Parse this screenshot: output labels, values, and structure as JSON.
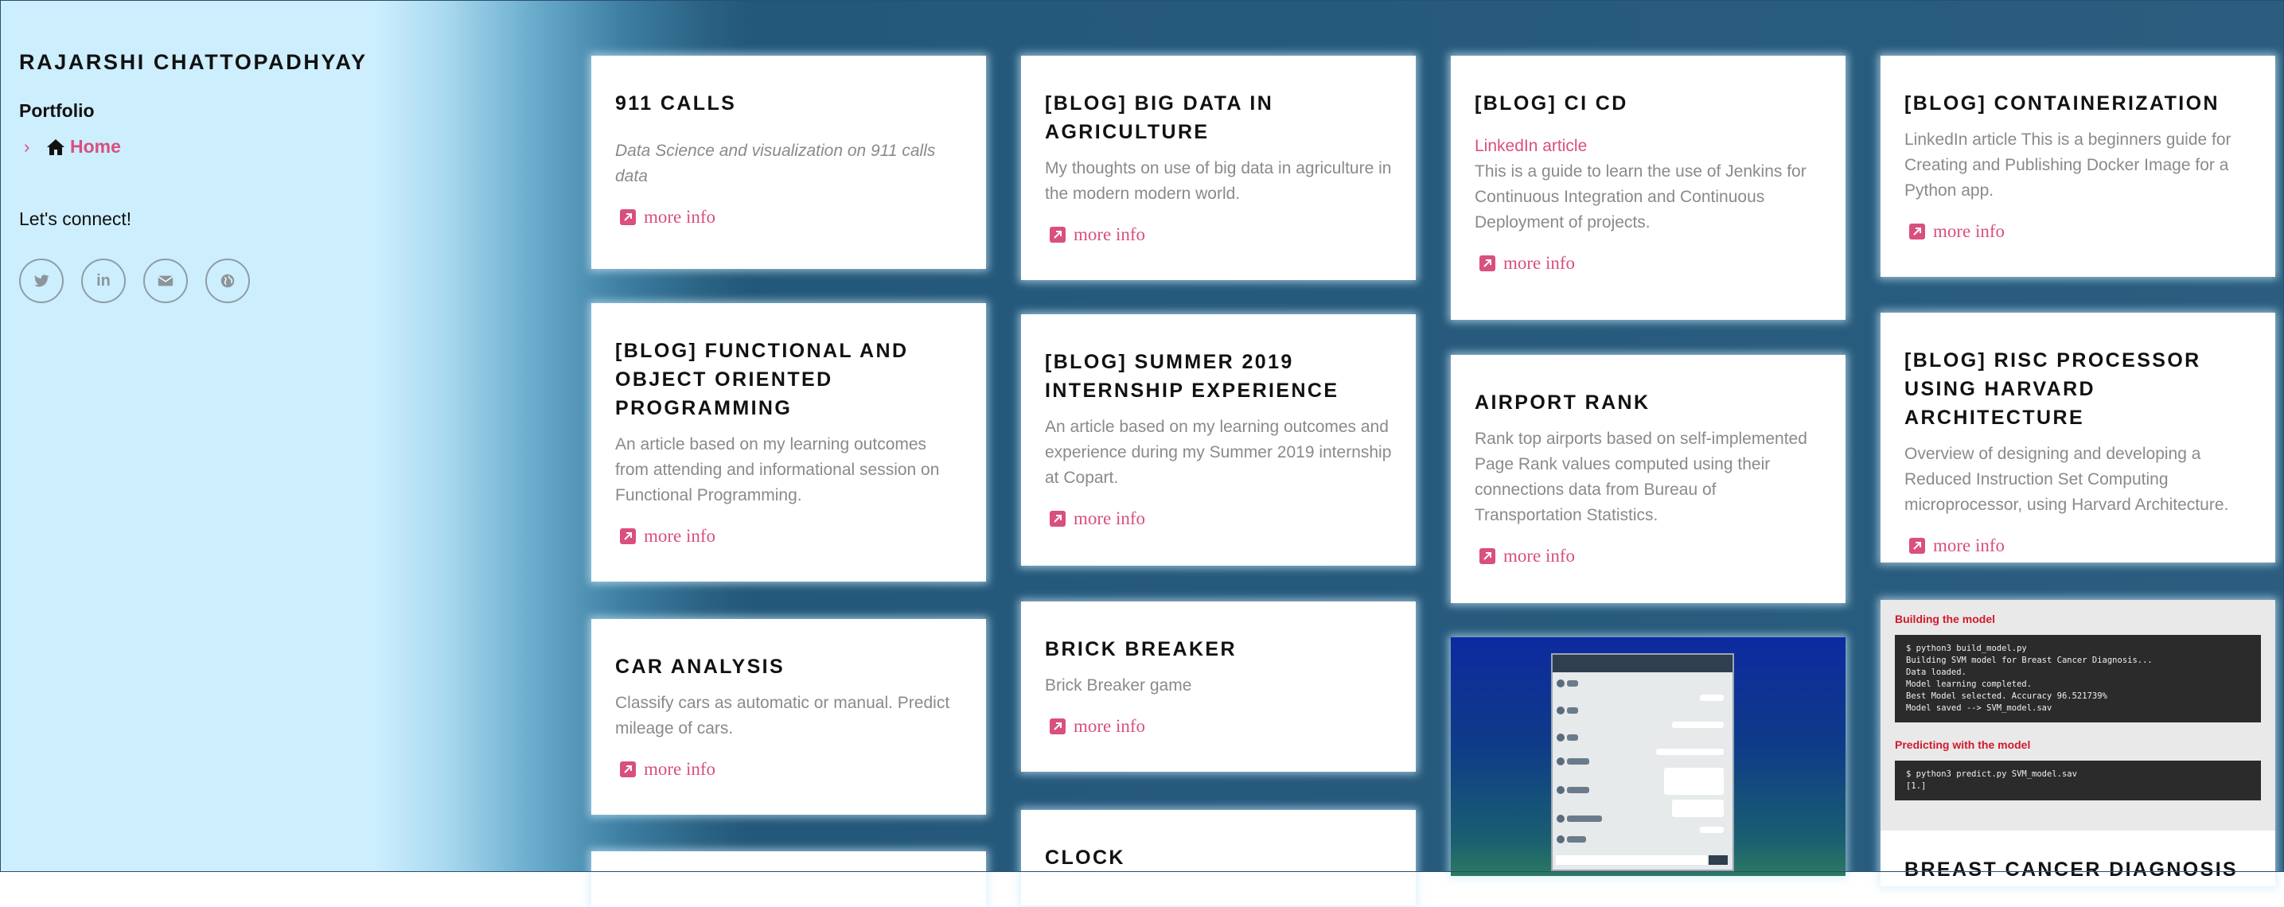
{
  "sidebar": {
    "site_title": "RAJARSHI CHATTOPADHYAY",
    "section_label": "Portfolio",
    "nav_home_label": "Home",
    "connect_label": "Let's connect!",
    "socials": [
      "twitter-icon",
      "linkedin-icon",
      "envelope-icon",
      "globe-icon"
    ]
  },
  "cards": {
    "calls": {
      "title": "911 CALLS",
      "desc": "Data Science and visualization on 911 calls data",
      "more": "more info"
    },
    "functional": {
      "title": "[BLOG] FUNCTIONAL AND OBJECT ORIENTED PROGRAMMING",
      "desc": "An article based on my learning outcomes from attending and informational session on Functional Programming.",
      "more": "more info"
    },
    "car": {
      "title": "CAR ANALYSIS",
      "desc": "Classify cars as automatic or manual. Predict mileage of cars.",
      "more": "more info"
    },
    "bigdata": {
      "title": "[BLOG] BIG DATA IN AGRICULTURE",
      "desc": "My thoughts on use of big data in agriculture in the modern modern world.",
      "more": "more info"
    },
    "summer": {
      "title": "[BLOG] SUMMER 2019 INTERNSHIP EXPERIENCE",
      "desc": "An article based on my learning outcomes and experience during my Summer 2019 internship at Copart.",
      "more": "more info"
    },
    "brick": {
      "title": "BRICK BREAKER",
      "desc": "Brick Breaker game",
      "more": "more info"
    },
    "clock": {
      "title": "CLOCK"
    },
    "cicd": {
      "title": "[BLOG] CI CD",
      "link": "LinkedIn article",
      "desc": "This is a guide to learn the use of Jenkins for Continuous Integration and Continuous Deployment of projects.",
      "more": "more info"
    },
    "airport": {
      "title": "AIRPORT RANK",
      "desc": "Rank top airports based on self-implemented Page Rank values computed using their connections data from Bureau of Transportation Statistics.",
      "more": "more info"
    },
    "container": {
      "title": "[BLOG] CONTAINERIZATION",
      "desc": "LinkedIn article This is a beginners guide for Creating and Publishing Docker Image for a Python app.",
      "more": "more info"
    },
    "risc": {
      "title": "[BLOG] RISC PROCESSOR USING HARVARD ARCHITECTURE",
      "desc": "Overview of designing and developing a Reduced Instruction Set Computing microprocessor, using Harvard Architecture.",
      "more": "more info"
    },
    "cancer": {
      "heading1": "Building the model",
      "terminal1": "$ python3 build_model.py\nBuilding SVM model for Breast Cancer Diagnosis...\nData loaded.\nModel learning completed.\nBest Model selected. Accuracy 96.521739%\nModel saved --> SVM_model.sav",
      "heading2": "Predicting with the model",
      "terminal2": "$ python3 predict.py SVM_model.sav\n[1.]",
      "title": "BREAST CANCER DIAGNOSIS"
    }
  },
  "colors": {
    "accent": "#d94f7e",
    "sidebar_bg": "#cdeefd",
    "main_bg": "#2a5d7f"
  }
}
